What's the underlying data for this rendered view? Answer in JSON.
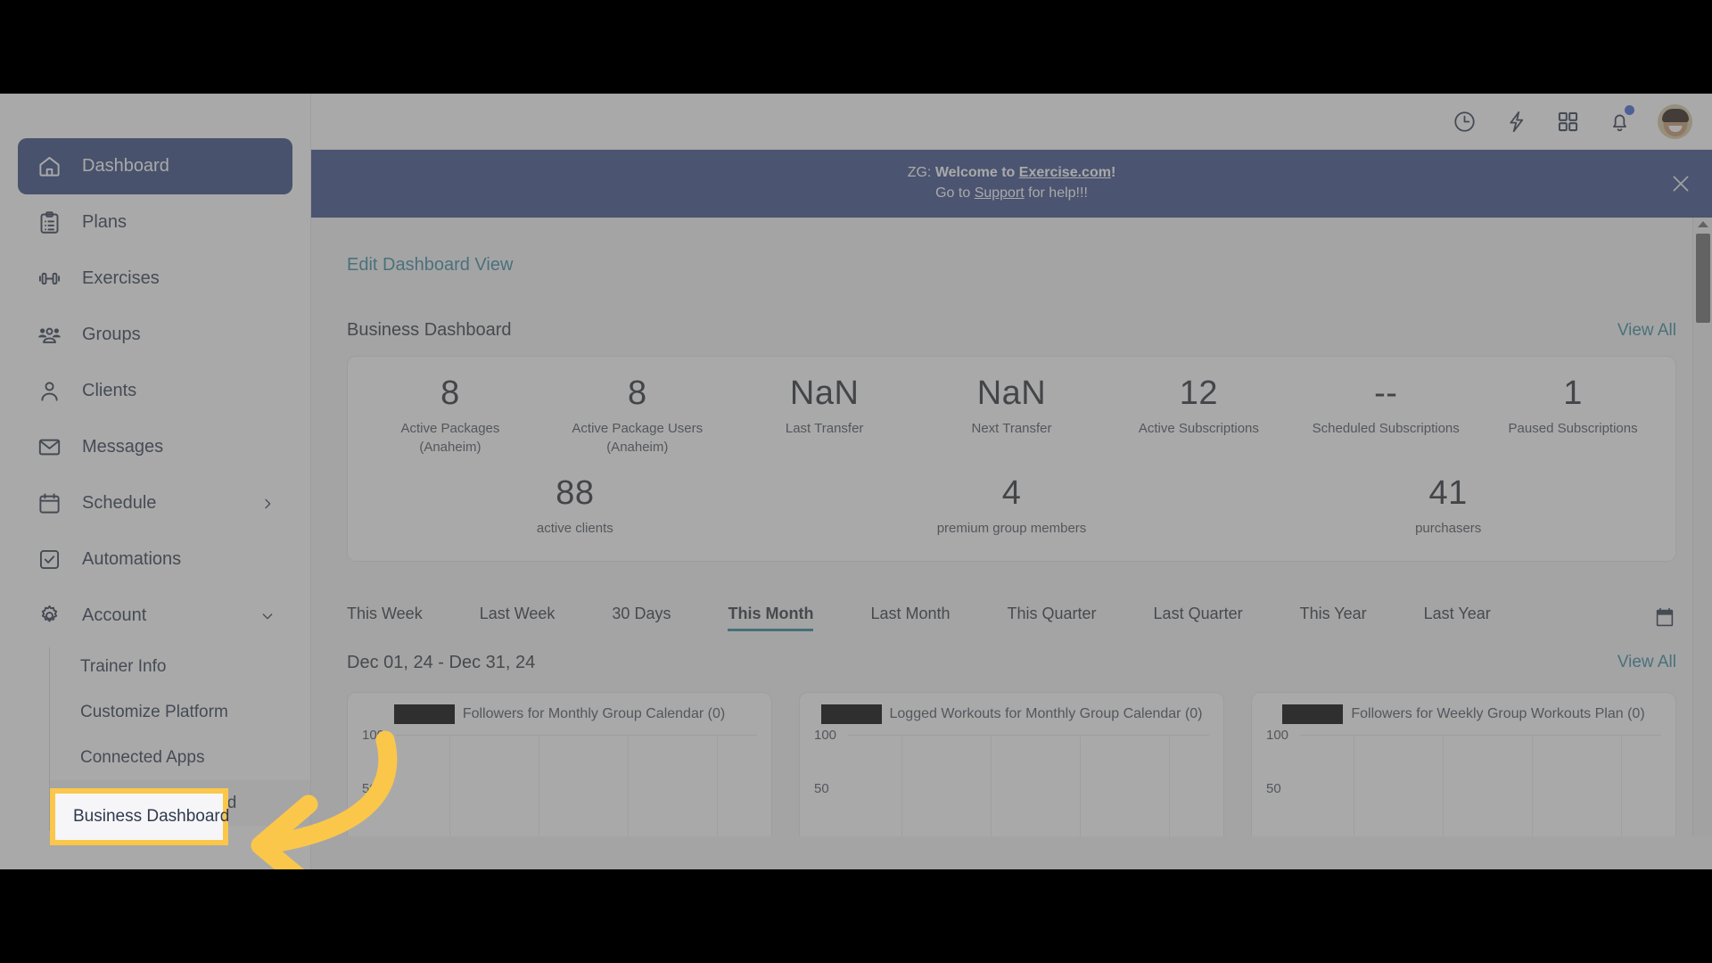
{
  "sidebar": {
    "items": [
      {
        "label": "Dashboard",
        "icon": "home-icon",
        "active": true
      },
      {
        "label": "Plans",
        "icon": "clipboard-icon",
        "active": false
      },
      {
        "label": "Exercises",
        "icon": "dumbbell-icon",
        "active": false
      },
      {
        "label": "Groups",
        "icon": "people-icon",
        "active": false
      },
      {
        "label": "Clients",
        "icon": "person-icon",
        "active": false
      },
      {
        "label": "Messages",
        "icon": "envelope-icon",
        "active": false
      },
      {
        "label": "Schedule",
        "icon": "calendar-icon",
        "active": false,
        "caret": "chevron-right-icon"
      },
      {
        "label": "Automations",
        "icon": "check-square-icon",
        "active": false
      },
      {
        "label": "Account",
        "icon": "gear-icon",
        "active": false,
        "caret": "chevron-down-icon"
      }
    ],
    "subitems": [
      {
        "label": "Trainer Info"
      },
      {
        "label": "Customize Platform"
      },
      {
        "label": "Connected Apps"
      },
      {
        "label": "Business Dashboard",
        "selected": true
      }
    ]
  },
  "topbar": {
    "icons": [
      {
        "name": "clock-icon"
      },
      {
        "name": "lightning-icon"
      },
      {
        "name": "grid-apps-icon"
      },
      {
        "name": "bell-icon",
        "badge": true
      }
    ],
    "avatar_alt": "user-avatar"
  },
  "banner": {
    "line1_lead": "ZG: ",
    "line1_bold": "Welcome to ",
    "line1_link": "Exercise.com",
    "line1_tail": "!",
    "line2_pre": "Go to ",
    "line2_link": "Support",
    "line2_post": " for help!!!",
    "close_icon": "close-icon"
  },
  "main": {
    "edit_link": "Edit Dashboard View",
    "section_title": "Business Dashboard",
    "view_all": "View All",
    "view_all_2": "View All",
    "stats_row1": [
      {
        "value": "8",
        "label": "Active Packages",
        "sub": "(Anaheim)"
      },
      {
        "value": "8",
        "label": "Active Package Users",
        "sub": "(Anaheim)"
      },
      {
        "value": "NaN",
        "label": "Last Transfer",
        "sub": ""
      },
      {
        "value": "NaN",
        "label": "Next Transfer",
        "sub": ""
      },
      {
        "value": "12",
        "label": "Active Subscriptions",
        "sub": ""
      },
      {
        "value": "--",
        "label": "Scheduled Subscriptions",
        "sub": ""
      },
      {
        "value": "1",
        "label": "Paused Subscriptions",
        "sub": ""
      }
    ],
    "stats_row2": [
      {
        "value": "88",
        "label": "active clients"
      },
      {
        "value": "4",
        "label": "premium group members"
      },
      {
        "value": "41",
        "label": "purchasers"
      }
    ],
    "range_tabs": [
      {
        "label": "This Week",
        "active": false
      },
      {
        "label": "Last Week",
        "active": false
      },
      {
        "label": "30 Days",
        "active": false
      },
      {
        "label": "This Month",
        "active": true
      },
      {
        "label": "Last Month",
        "active": false
      },
      {
        "label": "This Quarter",
        "active": false
      },
      {
        "label": "Last Quarter",
        "active": false
      },
      {
        "label": "This Year",
        "active": false
      },
      {
        "label": "Last Year",
        "active": false
      }
    ],
    "calendar_icon": "calendar-picker-icon",
    "date_range": "Dec 01, 24 - Dec 31, 24",
    "charts": [
      {
        "title": "Followers for Monthly Group Calendar (0)",
        "redacted": true
      },
      {
        "title": "Logged Workouts for Monthly Group Calendar (0)",
        "redacted": true
      },
      {
        "title": "Followers for Weekly Group Workouts Plan (0)",
        "redacted": true
      }
    ]
  },
  "chart_data": [
    {
      "type": "line",
      "title": "Followers for Monthly Group Calendar (0)",
      "series": [
        {
          "name": "Followers",
          "values": [
            0,
            0,
            0,
            0,
            0,
            0
          ]
        }
      ],
      "x": [
        "",
        "",
        "",
        "",
        "",
        ""
      ],
      "ylim": [
        0,
        100
      ],
      "yticks": [
        100,
        50
      ],
      "grid": true,
      "legend": "none"
    },
    {
      "type": "line",
      "title": "Logged Workouts for Monthly Group Calendar (0)",
      "series": [
        {
          "name": "Logged Workouts",
          "values": [
            0,
            0,
            0,
            0,
            0,
            0
          ]
        }
      ],
      "x": [
        "",
        "",
        "",
        "",
        "",
        ""
      ],
      "ylim": [
        0,
        100
      ],
      "yticks": [
        100,
        50
      ],
      "grid": true,
      "legend": "none"
    },
    {
      "type": "line",
      "title": "Followers for Weekly Group Workouts Plan (0)",
      "series": [
        {
          "name": "Followers",
          "values": [
            0,
            0,
            0,
            0,
            0,
            0
          ]
        }
      ],
      "x": [
        "",
        "",
        "",
        "",
        "",
        ""
      ],
      "ylim": [
        0,
        100
      ],
      "yticks": [
        100,
        50
      ],
      "grid": true,
      "legend": "none"
    }
  ],
  "annotation": {
    "highlight_label": "Business Dashboard",
    "highlight_color": "#FBC74A",
    "arrow_color": "#FBC74A",
    "arrow_name": "pointer-arrow"
  },
  "colors": {
    "accent_blue": "#36497f",
    "banner_blue": "#3b4f88",
    "link_teal": "#3a8b9e",
    "tab_underline": "#2a8a9a",
    "highlight_yellow": "#FBC74A"
  }
}
